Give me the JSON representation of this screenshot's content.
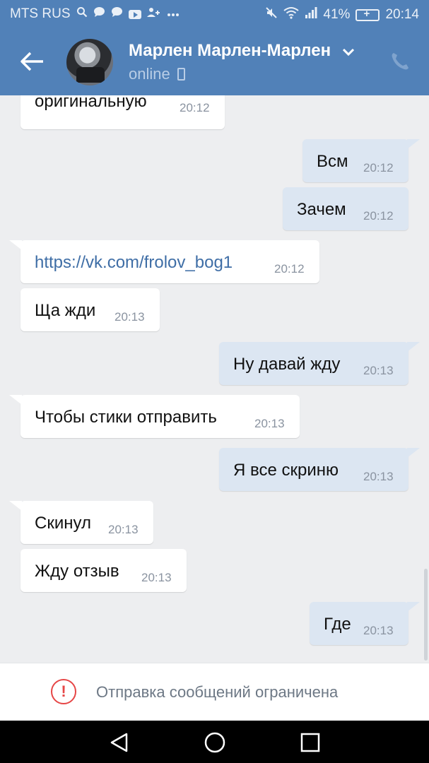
{
  "statusbar": {
    "carrier": "MTS RUS",
    "battery": "41%",
    "time": "20:14",
    "icons": [
      "search-icon",
      "chat-icon",
      "chat-icon",
      "youtube-icon",
      "add-person-icon",
      "more-icon",
      "mute-icon",
      "wifi-icon",
      "signal-icon",
      "battery-icon"
    ]
  },
  "header": {
    "contact_name": "Марлен Марлен-Марлен",
    "presence": "online",
    "accent_color": "#5181b8"
  },
  "messages": [
    {
      "dir": "in",
      "text": "оригинальную",
      "time": "20:12"
    },
    {
      "dir": "out",
      "text": "Всм",
      "time": "20:12"
    },
    {
      "dir": "out",
      "text": "Зачем",
      "time": "20:12"
    },
    {
      "dir": "in",
      "text": "https://vk.com/frolov_bog1",
      "time": "20:12",
      "link": true
    },
    {
      "dir": "in",
      "text": "Ща жди",
      "time": "20:13"
    },
    {
      "dir": "out",
      "text": "Ну давай жду",
      "time": "20:13"
    },
    {
      "dir": "in",
      "text": "Чтобы стики отправить",
      "time": "20:13"
    },
    {
      "dir": "out",
      "text": "Я все скриню",
      "time": "20:13"
    },
    {
      "dir": "in",
      "text": "Скинул",
      "time": "20:13"
    },
    {
      "dir": "in",
      "text": "Жду отзыв",
      "time": "20:13"
    },
    {
      "dir": "out",
      "text": "Где",
      "time": "20:13"
    }
  ],
  "restriction": {
    "text": "Отправка сообщений ограничена",
    "color": "#e64646"
  }
}
